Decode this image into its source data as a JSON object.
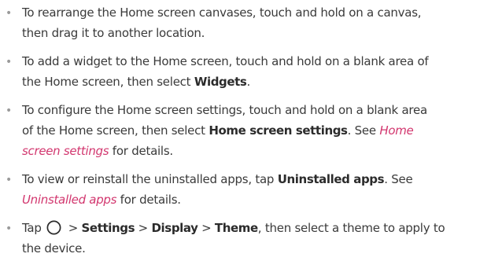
{
  "bullet_symbol": "•",
  "colors": {
    "text": "#3a3a3a",
    "bold_text": "#2b2b2b",
    "cross_reference": "#d2366e",
    "bullet": "#9a9a9a"
  },
  "items": [
    {
      "line1": "To rearrange the Home screen canvases, touch and hold on a canvas,",
      "line2": "then drag it to another location."
    },
    {
      "line1": "To add a widget to the Home screen, touch and hold on a blank area of",
      "line2_pre": "the Home screen, then select ",
      "line2_bold": "Widgets",
      "line2_post": "."
    },
    {
      "line1": "To configure the Home screen settings, touch and hold on a blank area",
      "line2_pre": "of the Home screen, then select ",
      "line2_bold": "Home screen settings",
      "line2_mid": ". See ",
      "line2_link": "Home",
      "line3_link": "screen settings",
      "line3_post": " for details."
    },
    {
      "line1_pre": "To view or reinstall the uninstalled apps, tap ",
      "line1_bold": "Uninstalled apps",
      "line1_post": ". See",
      "line2_link": "Uninstalled apps",
      "line2_post": " for details."
    },
    {
      "line1_pre": "Tap ",
      "icon": "home-circle-icon",
      "sep": " > ",
      "path": [
        "Settings",
        "Display",
        "Theme"
      ],
      "line1_post": ", then select a theme to apply to",
      "line2": "the device."
    }
  ]
}
